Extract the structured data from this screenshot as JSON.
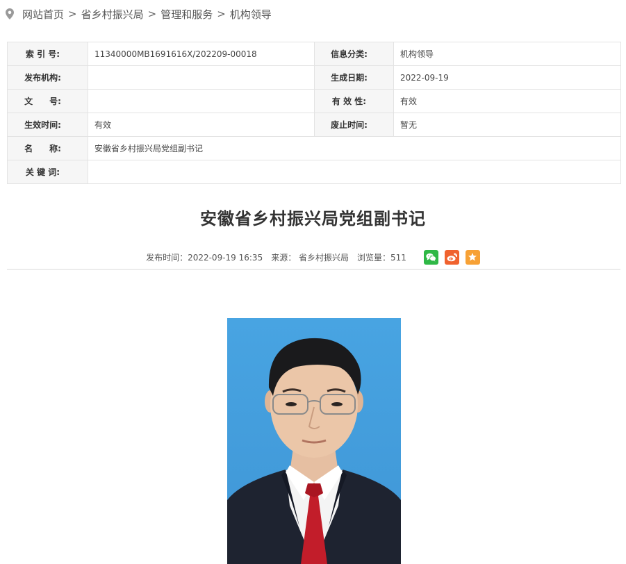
{
  "breadcrumb": {
    "icon": "location-pin-icon",
    "items": [
      "网站首页",
      "省乡村振兴局",
      "管理和服务",
      "机构领导"
    ],
    "separator": ">"
  },
  "meta": {
    "index_label": "索 引 号:",
    "index_value": "11340000MB1691616X/202209-00018",
    "category_label": "信息分类:",
    "category_value": "机构领导",
    "publisher_label": "发布机构:",
    "publisher_value": "",
    "date_label": "生成日期:",
    "date_value": "2022-09-19",
    "docno_label": "文　　号:",
    "docno_value": "",
    "validity_label": "有 效 性:",
    "validity_value": "有效",
    "effective_label": "生效时间:",
    "effective_value": "有效",
    "expire_label": "废止时间:",
    "expire_value": "暂无",
    "name_label": "名　　称:",
    "name_value": "安徽省乡村振兴局党组副书记",
    "keywords_label": "关 键 词:",
    "keywords_value": ""
  },
  "article": {
    "title": "安徽省乡村振兴局党组副书记",
    "publish_time": "发布时间：2022-09-19 16:35",
    "source": "来源：  省乡村振兴局",
    "views": "浏览量：511"
  },
  "share": {
    "icons": [
      "wechat-icon",
      "weibo-icon",
      "favorite-star-icon"
    ],
    "colors": {
      "wechat": "#2fb846",
      "weibo": "#f0622e",
      "favorite": "#f7a135"
    }
  },
  "colors": {
    "photo_background": "#47a2e0",
    "table_key_bg": "#f6f6f6",
    "border": "#e3e3e3"
  }
}
